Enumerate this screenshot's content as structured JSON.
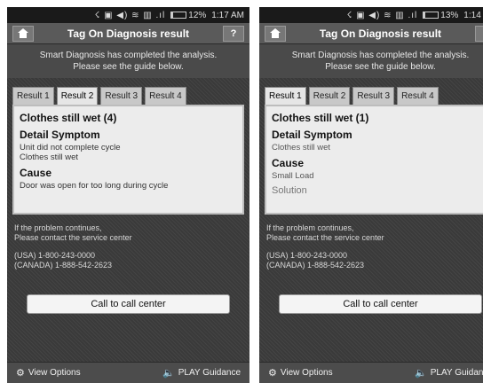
{
  "screens": [
    {
      "status": {
        "icons": "☇ ▣ ◀) ≋ ▥ .ıl",
        "battery_level": 0.12,
        "battery_text": "12%",
        "time": "1:17 AM"
      },
      "title": "Tag On Diagnosis result",
      "home_icon": "home-icon",
      "help_label": "?",
      "banner": {
        "line1": "Smart Diagnosis has completed the analysis.",
        "line2": "Please see the guide below."
      },
      "tabs": [
        "Result 1",
        "Result 2",
        "Result 3",
        "Result 4"
      ],
      "active_tab": 1,
      "panel": {
        "title": "Clothes still wet (4)",
        "detail_heading": "Detail Symptom",
        "detail_lines": [
          "Unit did not complete cycle",
          "Clothes still wet"
        ],
        "cause_heading": "Cause",
        "cause_text": "Door was open for too long during cycle"
      },
      "contact": {
        "line1": "If the problem continues,",
        "line2": "Please contact the service center",
        "usa": "(USA) 1-800-243-0000",
        "canada": "(CANADA) 1-888-542-2623"
      },
      "call_button": "Call to call center",
      "bottom": {
        "left": "View Options",
        "right": "PLAY Guidance"
      }
    },
    {
      "status": {
        "icons": "☇ ▣ ◀) ≋ ▥ .ıl",
        "battery_level": 0.13,
        "battery_text": "13%",
        "time": "1:14 AM"
      },
      "title": "Tag On Diagnosis result",
      "home_icon": "home-icon",
      "help_label": "?",
      "banner": {
        "line1": "Smart Diagnosis has completed the analysis.",
        "line2": "Please see the guide below."
      },
      "tabs": [
        "Result 1",
        "Result 2",
        "Result 3",
        "Result 4"
      ],
      "active_tab": 0,
      "panel": {
        "title": "Clothes still wet (1)",
        "detail_heading": "Detail Symptom",
        "detail_lines": [
          "Clothes still wet"
        ],
        "cause_heading": "Cause",
        "cause_text": "Small Load",
        "solution_heading": "Solution"
      },
      "contact": {
        "line1": "If the problem continues,",
        "line2": "Please contact the service center",
        "usa": "(USA) 1-800-243-0000",
        "canada": "(CANADA) 1-888-542-2623"
      },
      "call_button": "Call to call center",
      "bottom": {
        "left": "View Options",
        "right": "PLAY Guidance"
      }
    }
  ]
}
